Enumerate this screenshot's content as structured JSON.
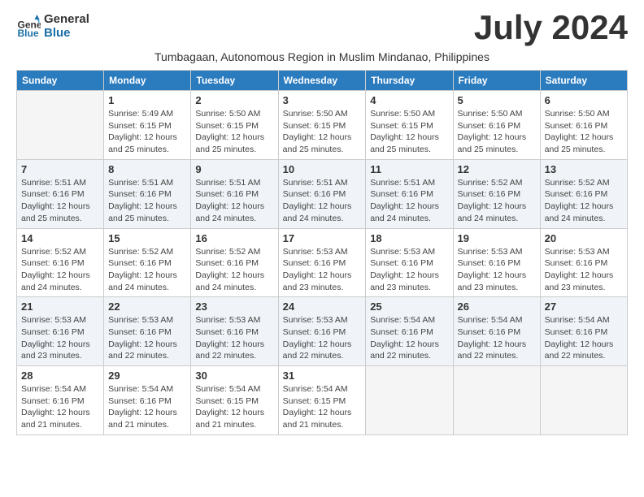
{
  "header": {
    "logo_line1": "General",
    "logo_line2": "Blue",
    "month": "July 2024",
    "subtitle": "Tumbagaan, Autonomous Region in Muslim Mindanao, Philippines"
  },
  "weekdays": [
    "Sunday",
    "Monday",
    "Tuesday",
    "Wednesday",
    "Thursday",
    "Friday",
    "Saturday"
  ],
  "weeks": [
    [
      {
        "day": "",
        "sunrise": "",
        "sunset": "",
        "daylight": ""
      },
      {
        "day": "1",
        "sunrise": "Sunrise: 5:49 AM",
        "sunset": "Sunset: 6:15 PM",
        "daylight": "Daylight: 12 hours and 25 minutes."
      },
      {
        "day": "2",
        "sunrise": "Sunrise: 5:50 AM",
        "sunset": "Sunset: 6:15 PM",
        "daylight": "Daylight: 12 hours and 25 minutes."
      },
      {
        "day": "3",
        "sunrise": "Sunrise: 5:50 AM",
        "sunset": "Sunset: 6:15 PM",
        "daylight": "Daylight: 12 hours and 25 minutes."
      },
      {
        "day": "4",
        "sunrise": "Sunrise: 5:50 AM",
        "sunset": "Sunset: 6:15 PM",
        "daylight": "Daylight: 12 hours and 25 minutes."
      },
      {
        "day": "5",
        "sunrise": "Sunrise: 5:50 AM",
        "sunset": "Sunset: 6:16 PM",
        "daylight": "Daylight: 12 hours and 25 minutes."
      },
      {
        "day": "6",
        "sunrise": "Sunrise: 5:50 AM",
        "sunset": "Sunset: 6:16 PM",
        "daylight": "Daylight: 12 hours and 25 minutes."
      }
    ],
    [
      {
        "day": "7",
        "sunrise": "Sunrise: 5:51 AM",
        "sunset": "Sunset: 6:16 PM",
        "daylight": "Daylight: 12 hours and 25 minutes."
      },
      {
        "day": "8",
        "sunrise": "Sunrise: 5:51 AM",
        "sunset": "Sunset: 6:16 PM",
        "daylight": "Daylight: 12 hours and 25 minutes."
      },
      {
        "day": "9",
        "sunrise": "Sunrise: 5:51 AM",
        "sunset": "Sunset: 6:16 PM",
        "daylight": "Daylight: 12 hours and 24 minutes."
      },
      {
        "day": "10",
        "sunrise": "Sunrise: 5:51 AM",
        "sunset": "Sunset: 6:16 PM",
        "daylight": "Daylight: 12 hours and 24 minutes."
      },
      {
        "day": "11",
        "sunrise": "Sunrise: 5:51 AM",
        "sunset": "Sunset: 6:16 PM",
        "daylight": "Daylight: 12 hours and 24 minutes."
      },
      {
        "day": "12",
        "sunrise": "Sunrise: 5:52 AM",
        "sunset": "Sunset: 6:16 PM",
        "daylight": "Daylight: 12 hours and 24 minutes."
      },
      {
        "day": "13",
        "sunrise": "Sunrise: 5:52 AM",
        "sunset": "Sunset: 6:16 PM",
        "daylight": "Daylight: 12 hours and 24 minutes."
      }
    ],
    [
      {
        "day": "14",
        "sunrise": "Sunrise: 5:52 AM",
        "sunset": "Sunset: 6:16 PM",
        "daylight": "Daylight: 12 hours and 24 minutes."
      },
      {
        "day": "15",
        "sunrise": "Sunrise: 5:52 AM",
        "sunset": "Sunset: 6:16 PM",
        "daylight": "Daylight: 12 hours and 24 minutes."
      },
      {
        "day": "16",
        "sunrise": "Sunrise: 5:52 AM",
        "sunset": "Sunset: 6:16 PM",
        "daylight": "Daylight: 12 hours and 24 minutes."
      },
      {
        "day": "17",
        "sunrise": "Sunrise: 5:53 AM",
        "sunset": "Sunset: 6:16 PM",
        "daylight": "Daylight: 12 hours and 23 minutes."
      },
      {
        "day": "18",
        "sunrise": "Sunrise: 5:53 AM",
        "sunset": "Sunset: 6:16 PM",
        "daylight": "Daylight: 12 hours and 23 minutes."
      },
      {
        "day": "19",
        "sunrise": "Sunrise: 5:53 AM",
        "sunset": "Sunset: 6:16 PM",
        "daylight": "Daylight: 12 hours and 23 minutes."
      },
      {
        "day": "20",
        "sunrise": "Sunrise: 5:53 AM",
        "sunset": "Sunset: 6:16 PM",
        "daylight": "Daylight: 12 hours and 23 minutes."
      }
    ],
    [
      {
        "day": "21",
        "sunrise": "Sunrise: 5:53 AM",
        "sunset": "Sunset: 6:16 PM",
        "daylight": "Daylight: 12 hours and 23 minutes."
      },
      {
        "day": "22",
        "sunrise": "Sunrise: 5:53 AM",
        "sunset": "Sunset: 6:16 PM",
        "daylight": "Daylight: 12 hours and 22 minutes."
      },
      {
        "day": "23",
        "sunrise": "Sunrise: 5:53 AM",
        "sunset": "Sunset: 6:16 PM",
        "daylight": "Daylight: 12 hours and 22 minutes."
      },
      {
        "day": "24",
        "sunrise": "Sunrise: 5:53 AM",
        "sunset": "Sunset: 6:16 PM",
        "daylight": "Daylight: 12 hours and 22 minutes."
      },
      {
        "day": "25",
        "sunrise": "Sunrise: 5:54 AM",
        "sunset": "Sunset: 6:16 PM",
        "daylight": "Daylight: 12 hours and 22 minutes."
      },
      {
        "day": "26",
        "sunrise": "Sunrise: 5:54 AM",
        "sunset": "Sunset: 6:16 PM",
        "daylight": "Daylight: 12 hours and 22 minutes."
      },
      {
        "day": "27",
        "sunrise": "Sunrise: 5:54 AM",
        "sunset": "Sunset: 6:16 PM",
        "daylight": "Daylight: 12 hours and 22 minutes."
      }
    ],
    [
      {
        "day": "28",
        "sunrise": "Sunrise: 5:54 AM",
        "sunset": "Sunset: 6:16 PM",
        "daylight": "Daylight: 12 hours and 21 minutes."
      },
      {
        "day": "29",
        "sunrise": "Sunrise: 5:54 AM",
        "sunset": "Sunset: 6:16 PM",
        "daylight": "Daylight: 12 hours and 21 minutes."
      },
      {
        "day": "30",
        "sunrise": "Sunrise: 5:54 AM",
        "sunset": "Sunset: 6:15 PM",
        "daylight": "Daylight: 12 hours and 21 minutes."
      },
      {
        "day": "31",
        "sunrise": "Sunrise: 5:54 AM",
        "sunset": "Sunset: 6:15 PM",
        "daylight": "Daylight: 12 hours and 21 minutes."
      },
      {
        "day": "",
        "sunrise": "",
        "sunset": "",
        "daylight": ""
      },
      {
        "day": "",
        "sunrise": "",
        "sunset": "",
        "daylight": ""
      },
      {
        "day": "",
        "sunrise": "",
        "sunset": "",
        "daylight": ""
      }
    ]
  ]
}
